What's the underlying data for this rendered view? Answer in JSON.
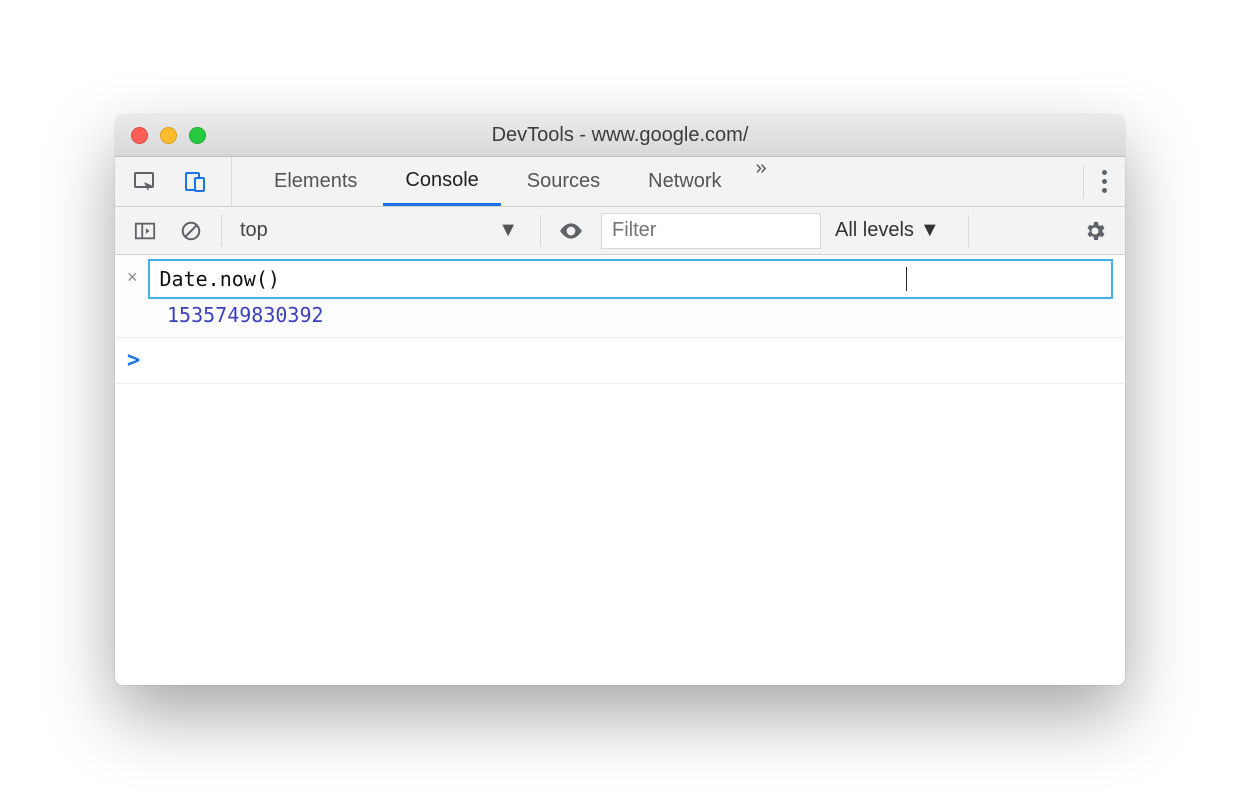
{
  "window": {
    "title": "DevTools - www.google.com/"
  },
  "tabs": {
    "items": [
      "Elements",
      "Console",
      "Sources",
      "Network"
    ],
    "active_index": 1,
    "overflow_glyph": "»"
  },
  "filterbar": {
    "context": "top",
    "filter_placeholder": "Filter",
    "filter_value": "",
    "levels_label": "All levels",
    "dropdown_glyph": "▼"
  },
  "console": {
    "expression": "Date.now()",
    "result": "1535749830392",
    "prompt_glyph": ">"
  },
  "icons": {
    "close_entry": "×"
  }
}
